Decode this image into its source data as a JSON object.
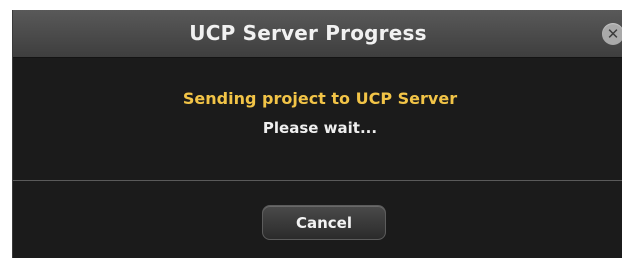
{
  "dialog": {
    "title": "UCP Server Progress",
    "close_icon": "close-x-icon",
    "close_glyph": "✕",
    "message": "Sending project to UCP Server",
    "subtext": "Please wait...",
    "cancel_label": "Cancel"
  },
  "colors": {
    "message_text": "#f2c447",
    "dialog_background": "#1b1b1b",
    "titlebar": "#4a4a4a"
  }
}
